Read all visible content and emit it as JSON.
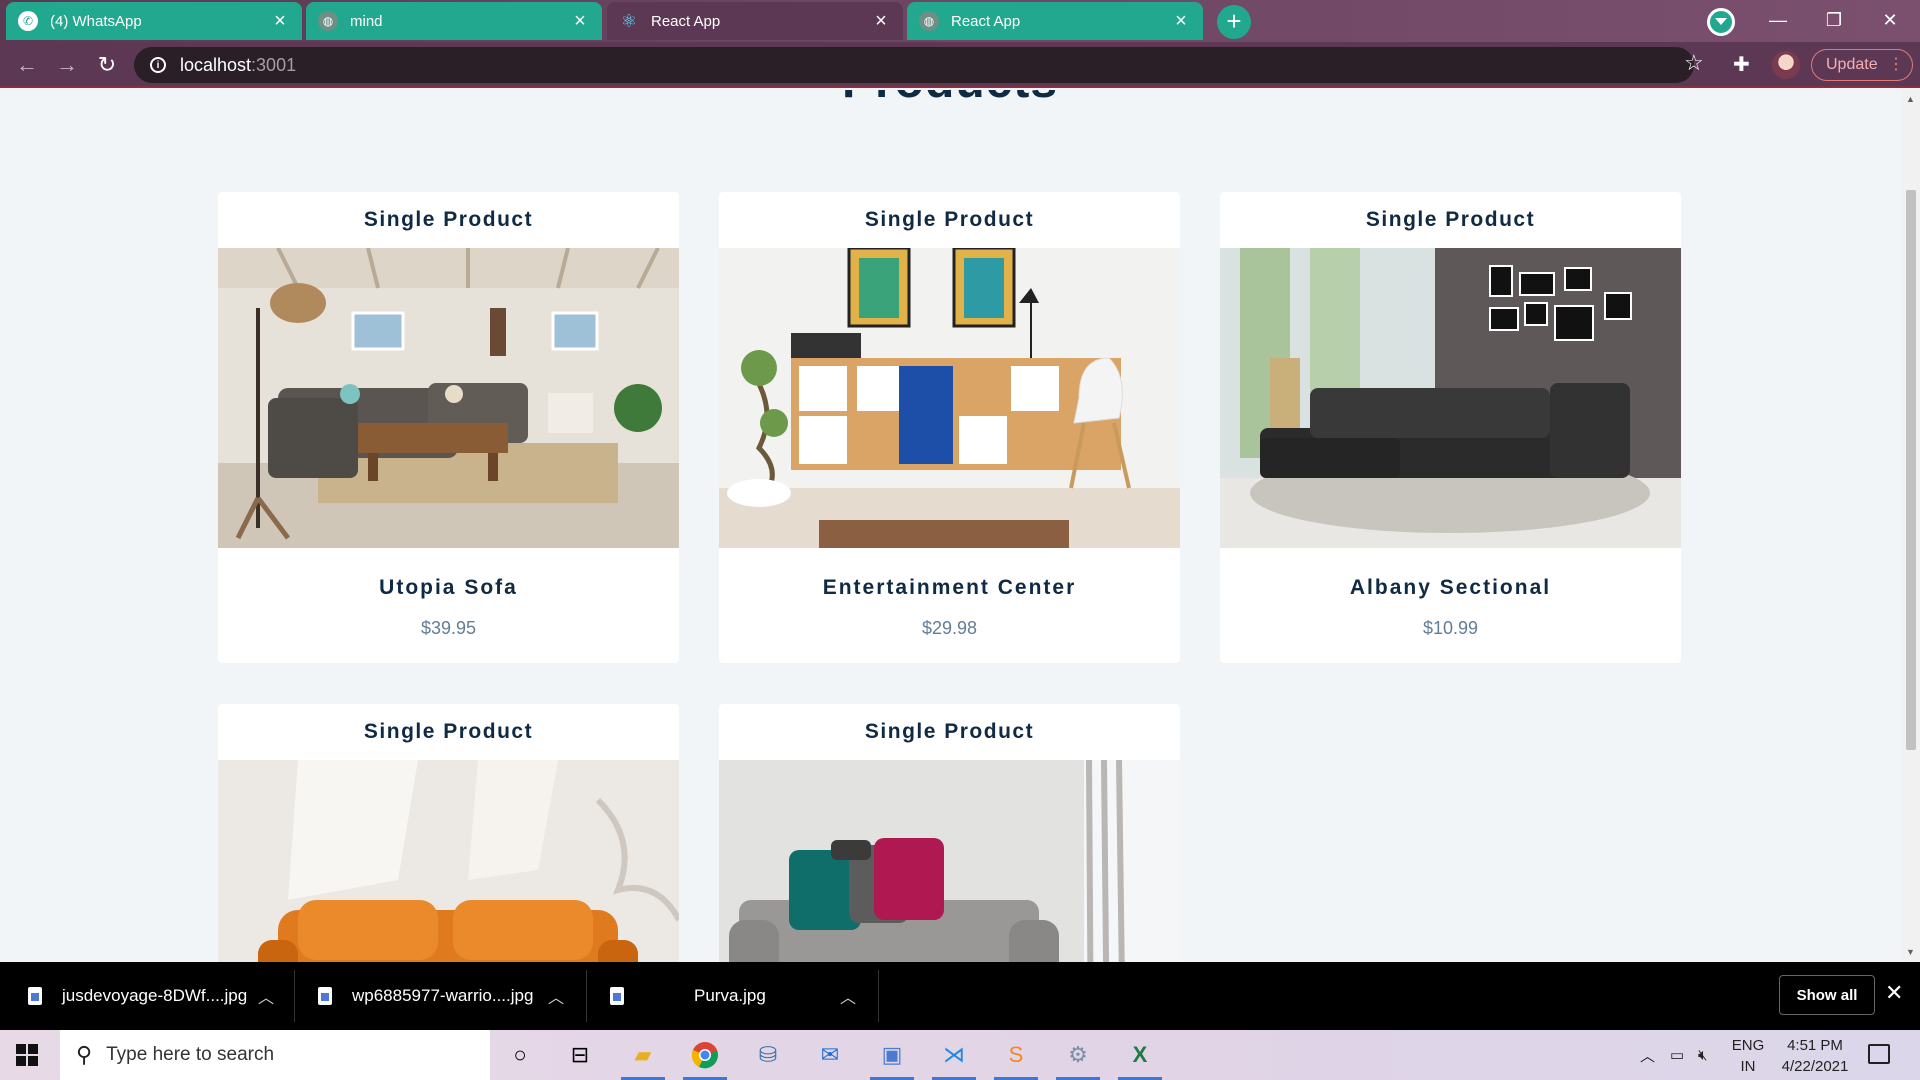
{
  "browser": {
    "tabs": [
      {
        "label": "(4) WhatsApp",
        "icon": "whatsapp-icon"
      },
      {
        "label": "mind",
        "icon": "globe-icon"
      },
      {
        "label": "React App",
        "icon": "react-icon"
      },
      {
        "label": "React App",
        "icon": "globe-icon"
      }
    ],
    "new_tab": "+",
    "address": {
      "host": "localhost",
      "port": ":3001"
    },
    "update_label": "Update"
  },
  "page": {
    "title": "Products",
    "products": [
      {
        "heading": "Single Product",
        "name": "Utopia Sofa",
        "price": "$39.95"
      },
      {
        "heading": "Single Product",
        "name": "Entertainment Center",
        "price": "$29.98"
      },
      {
        "heading": "Single Product",
        "name": "Albany Sectional",
        "price": "$10.99"
      },
      {
        "heading": "Single Product"
      },
      {
        "heading": "Single Product"
      }
    ]
  },
  "downloads": {
    "items": [
      {
        "filename": "jusdevoyage-8DWf....jpg"
      },
      {
        "filename": "wp6885977-warrio....jpg"
      },
      {
        "filename": "Purva.jpg"
      }
    ],
    "show_all": "Show all"
  },
  "taskbar": {
    "search_placeholder": "Type here to search",
    "lang_top": "ENG",
    "lang_bottom": "IN",
    "time": "4:51 PM",
    "date": "4/22/2021"
  },
  "colors": {
    "tab_green": "#22a88e",
    "tab_active": "#5d3855",
    "page_bg": "#f1f5f8",
    "heading": "#102a43",
    "price": "#627d98"
  }
}
